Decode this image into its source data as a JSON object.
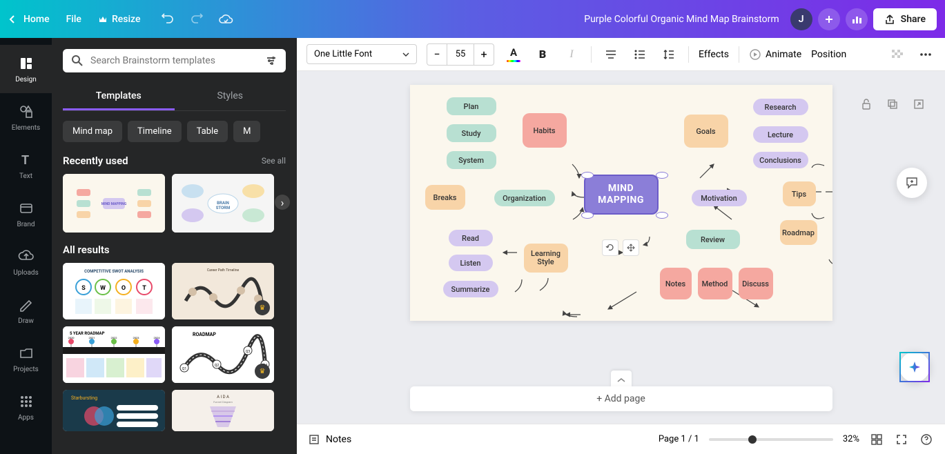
{
  "header": {
    "home": "Home",
    "file": "File",
    "resize": "Resize",
    "doc_title": "Purple Colorful Organic Mind Map Brainstorm",
    "avatar_initial": "J",
    "share": "Share"
  },
  "rail": {
    "items": [
      {
        "label": "Design"
      },
      {
        "label": "Elements"
      },
      {
        "label": "Text"
      },
      {
        "label": "Brand"
      },
      {
        "label": "Uploads"
      },
      {
        "label": "Draw"
      },
      {
        "label": "Projects"
      },
      {
        "label": "Apps"
      }
    ]
  },
  "side": {
    "search_placeholder": "Search Brainstorm templates",
    "tabs": {
      "templates": "Templates",
      "styles": "Styles"
    },
    "chips": [
      "Mind map",
      "Timeline",
      "Table",
      "M"
    ],
    "recently_used": "Recently used",
    "see_all": "See all",
    "all_results": "All results"
  },
  "thumbs": {
    "recent": [
      "MIND MAPPING",
      "BRAIN STORM"
    ],
    "grid": [
      "COMPETITIVE SWOT ANALYSIS",
      "Career Path Timeline",
      "5 YEAR ROADMAP",
      "ROADMAP",
      "Starbursting",
      "A I D A"
    ]
  },
  "editor_toolbar": {
    "font": "One Little Font",
    "size": "55",
    "effects": "Effects",
    "animate": "Animate",
    "position": "Position"
  },
  "canvas": {
    "center": "MIND\nMAPPING",
    "nodes": {
      "plan": "Plan",
      "study": "Study",
      "system": "System",
      "habits": "Habits",
      "goals": "Goals",
      "research": "Research",
      "lecture": "Lecture",
      "conclusions": "Conclusions",
      "breaks": "Breaks",
      "organization": "Organization",
      "motivation": "Motivation",
      "tips": "Tips",
      "read": "Read",
      "listen": "Listen",
      "summarize": "Summarize",
      "learning_style": "Learning\nStyle",
      "review": "Review",
      "notes": "Notes",
      "method": "Method",
      "discuss": "Discuss",
      "roadmap": "Roadmap"
    },
    "add_page": "+ Add page"
  },
  "bottom": {
    "notes": "Notes",
    "page": "Page 1 / 1",
    "zoom": "32%"
  },
  "colors": {
    "mint": "#b8e0d2",
    "salmon": "#f5a8a0",
    "peach": "#f8d4a8",
    "lavender": "#d4c8f0",
    "purple": "#8b7ed8"
  }
}
